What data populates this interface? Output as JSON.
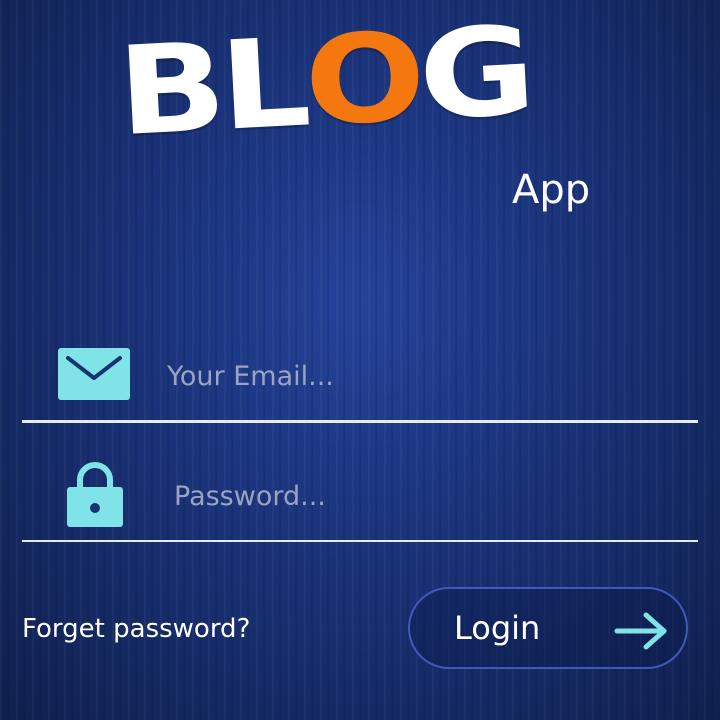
{
  "logo": {
    "word_start": "BL",
    "word_o": "O",
    "word_end": "G",
    "subtitle": "App"
  },
  "email_field": {
    "value": "",
    "placeholder": "Your Email...",
    "icon": "envelope-icon"
  },
  "password_field": {
    "value": "",
    "placeholder": "Password...",
    "icon": "lock-icon"
  },
  "forget_link": "Forget password?",
  "login_button": {
    "label": "Login",
    "icon": "arrow-right-icon"
  },
  "colors": {
    "background": "#1a3278",
    "logo_white": "#ffffff",
    "logo_accent": "#f4770f",
    "icon_cyan": "#7fe3e8",
    "placeholder": "#9aa3c0",
    "button_border": "#3e5ab8"
  }
}
